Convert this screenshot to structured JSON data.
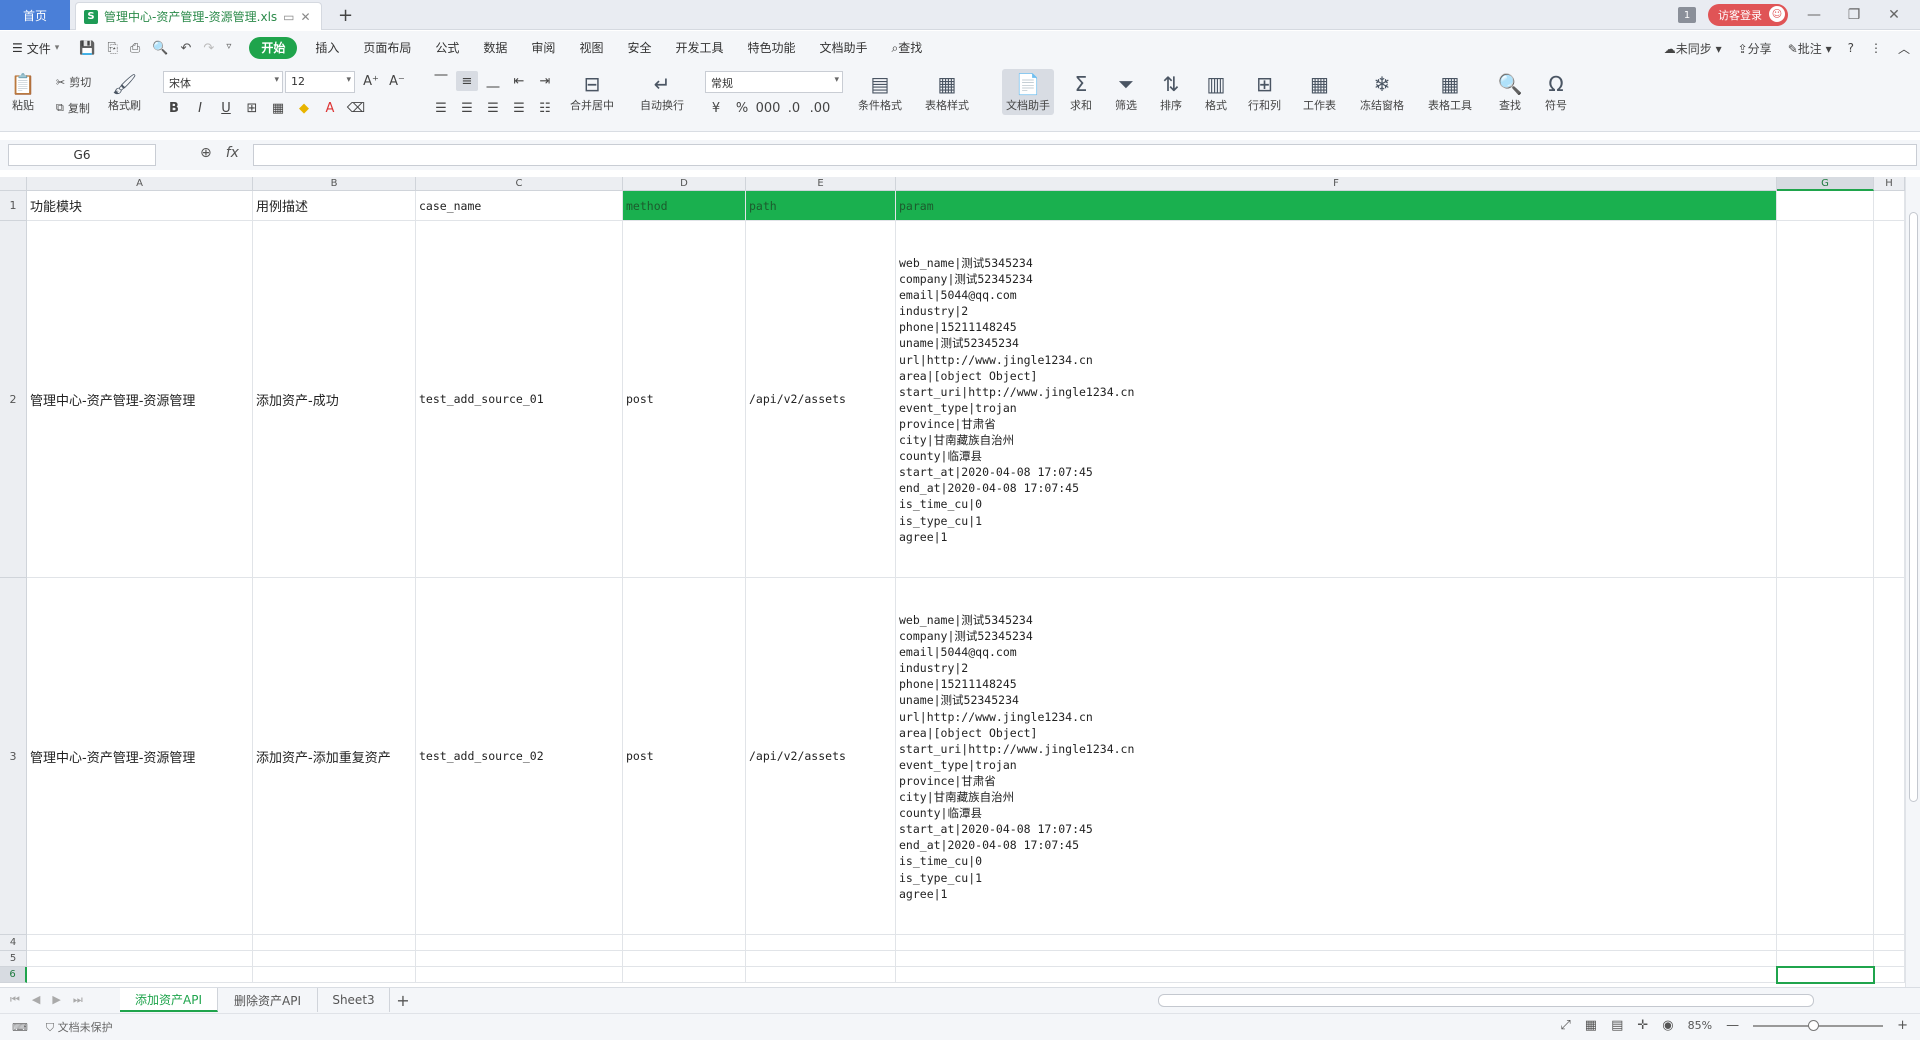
{
  "titlebar": {
    "home_tab": "首页",
    "doc_tab_name": "管理中心-资产管理-资源管理.xls",
    "doc_icon_letter": "S",
    "window_count": "1",
    "login_label": "访客登录",
    "new_tab": "+"
  },
  "menu": {
    "file": "文件",
    "items": [
      "开始",
      "插入",
      "页面布局",
      "公式",
      "数据",
      "审阅",
      "视图",
      "安全",
      "开发工具",
      "特色功能",
      "文档助手"
    ],
    "search": "查找",
    "sync": "未同步",
    "share": "分享",
    "comment": "批注",
    "help": "?"
  },
  "ribbon": {
    "paste": "粘贴",
    "cut": "剪切",
    "copy": "复制",
    "format_painter": "格式刷",
    "font_name": "宋体",
    "font_size": "12",
    "merge_center": "合并居中",
    "wrap_text": "自动换行",
    "number_format": "常规",
    "cond_format": "条件格式",
    "table_style": "表格样式",
    "doc_helper": "文档助手",
    "sum": "求和",
    "filter": "筛选",
    "sort": "排序",
    "format": "格式",
    "rows_cols": "行和列",
    "worksheet": "工作表",
    "freeze": "冻结窗格",
    "table_tools": "表格工具",
    "find": "查找",
    "symbol": "符号"
  },
  "formula_bar": {
    "cell_ref": "G6",
    "fx": "fx",
    "formula": ""
  },
  "grid": {
    "columns": [
      "A",
      "B",
      "C",
      "D",
      "E",
      "F",
      "G",
      "H"
    ],
    "selected_column": "G",
    "row_numbers": [
      "1",
      "2",
      "3",
      "4",
      "5",
      "6"
    ],
    "selected_row": "6",
    "header": [
      "功能模块",
      "用例描述",
      "case_name",
      "method",
      "path",
      "param"
    ],
    "rows": [
      {
        "module": "管理中心-资产管理-资源管理",
        "desc": "添加资产-成功",
        "case_name": "test_add_source_01",
        "method": "post",
        "path": "/api/v2/assets",
        "param": "web_name|测试5345234\ncompany|测试52345234\nemail|5044@qq.com\nindustry|2\nphone|15211148245\nuname|测试52345234\nurl|http://www.jingle1234.cn\narea|[object Object]\nstart_uri|http://www.jingle1234.cn\nevent_type|trojan\nprovince|甘肃省\ncity|甘南藏族自治州\ncounty|临潭县\nstart_at|2020-04-08 17:07:45\nend_at|2020-04-08 17:07:45\nis_time_cu|0\nis_type_cu|1\nagree|1"
      },
      {
        "module": "管理中心-资产管理-资源管理",
        "desc": "添加资产-添加重复资产",
        "case_name": "test_add_source_02",
        "method": "post",
        "path": "/api/v2/assets",
        "param": "web_name|测试5345234\ncompany|测试52345234\nemail|5044@qq.com\nindustry|2\nphone|15211148245\nuname|测试52345234\nurl|http://www.jingle1234.cn\narea|[object Object]\nstart_uri|http://www.jingle1234.cn\nevent_type|trojan\nprovince|甘肃省\ncity|甘南藏族自治州\ncounty|临潭县\nstart_at|2020-04-08 17:07:45\nend_at|2020-04-08 17:07:45\nis_time_cu|0\nis_type_cu|1\nagree|1"
      }
    ],
    "header_highlight_color": "#1ab04f"
  },
  "sheets": {
    "tabs": [
      "添加资产API",
      "删除资产API",
      "Sheet3"
    ],
    "active": "添加资产API",
    "add": "+"
  },
  "status": {
    "protect": "文档未保护",
    "zoom": "85%"
  }
}
